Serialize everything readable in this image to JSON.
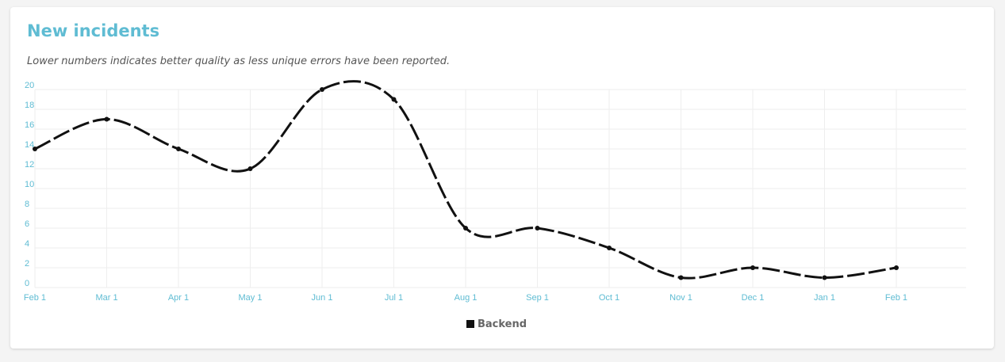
{
  "card": {
    "title": "New incidents",
    "subtitle": "Lower numbers indicates better quality as less unique errors have been reported."
  },
  "chart_data": {
    "type": "line",
    "categories": [
      "Feb 1",
      "Mar 1",
      "Apr 1",
      "May 1",
      "Jun 1",
      "Jul 1",
      "Aug 1",
      "Sep 1",
      "Oct 1",
      "Nov 1",
      "Dec 1",
      "Jan 1",
      "Feb 1"
    ],
    "series": [
      {
        "name": "Backend",
        "values": [
          14,
          17,
          14,
          12,
          20,
          19,
          6,
          6,
          4,
          1,
          2,
          1,
          2
        ],
        "color": "#111111"
      }
    ],
    "ylim": [
      0,
      20
    ],
    "yticks": [
      0,
      2,
      4,
      6,
      8,
      10,
      12,
      14,
      16,
      18,
      20
    ],
    "grid": true,
    "line_style": "dashed",
    "legend": "bottom-center",
    "tick_color": "#5fbcd3",
    "grid_color": "#eeeeee"
  }
}
